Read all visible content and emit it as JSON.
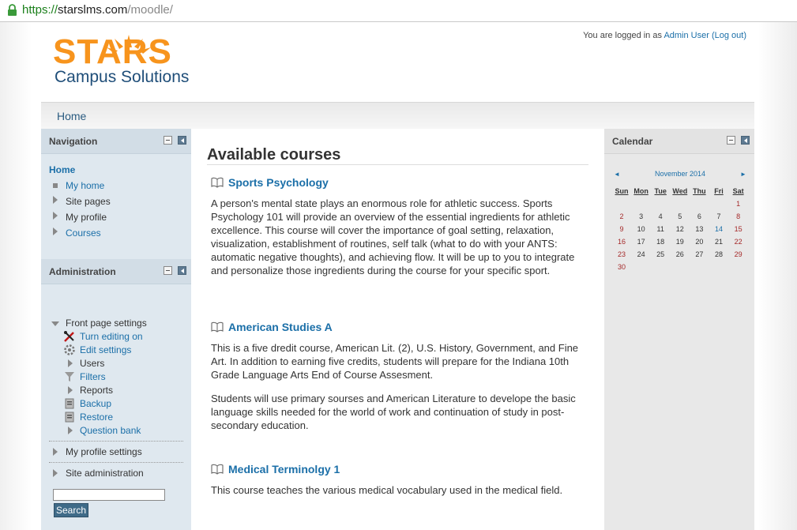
{
  "browser": {
    "url_protocol": "https://",
    "url_host": "starslms.com",
    "url_path": "/moodle/"
  },
  "header": {
    "logo_text": "STARS",
    "logo_subtext": "Campus Solutions",
    "login_prefix": "You are logged in as",
    "user_name": "Admin User",
    "logout_label": "(Log out)"
  },
  "breadcrumb": {
    "home": "Home"
  },
  "navigation": {
    "title": "Navigation",
    "home": "Home",
    "items": [
      {
        "label": "My home",
        "link": true
      },
      {
        "label": "Site pages",
        "link": false
      },
      {
        "label": "My profile",
        "link": false
      },
      {
        "label": "Courses",
        "link": true
      }
    ]
  },
  "administration": {
    "title": "Administration",
    "front_page_settings": "Front page settings",
    "front_items": [
      {
        "label": "Turn editing on",
        "icon": "edit-tools-icon",
        "link": true
      },
      {
        "label": "Edit settings",
        "icon": "gear-icon",
        "link": true
      },
      {
        "label": "Users",
        "icon": "expand-arrow-icon",
        "link": false
      },
      {
        "label": "Filters",
        "icon": "filter-icon",
        "link": true
      },
      {
        "label": "Reports",
        "icon": "expand-arrow-icon",
        "link": false
      },
      {
        "label": "Backup",
        "icon": "backup-icon",
        "link": true
      },
      {
        "label": "Restore",
        "icon": "restore-icon",
        "link": true
      },
      {
        "label": "Question bank",
        "icon": "expand-arrow-icon",
        "link": true
      }
    ],
    "my_profile_settings": "My profile settings",
    "site_administration": "Site administration",
    "search_button": "Search",
    "search_value": ""
  },
  "main": {
    "heading": "Available courses",
    "courses": [
      {
        "title": "Sports Psychology",
        "paragraphs": [
          "A person's mental state plays an enormous role for athletic success. Sports Psychology 101 will provide an overview of the essential ingredients for athletic excellence. This course will cover the importance of goal setting, relaxation, visualization, establishment of routines, self talk (what to do with your ANTS: automatic negative thoughts), and achieving flow. It will be up to you to integrate and personalize those ingredients during the course for your specific sport."
        ]
      },
      {
        "title": "American Studies A",
        "paragraphs": [
          "This is a five dredit course, American Lit. (2), U.S. History, Government, and Fine Art. In addition to earning five credits, students will prepare for the Indiana 10th Grade Language Arts End of Course Assesment.",
          "Students will use primary sourses and American Literature to develope the basic language skills needed for the world of work and continuation of study in post-secondary education."
        ]
      },
      {
        "title": "Medical Terminolgy 1",
        "paragraphs": [
          "This course teaches the various medical vocabulary used in the medical field."
        ]
      }
    ]
  },
  "calendar": {
    "title": "Calendar",
    "month": "November 2014",
    "prev": "◄",
    "next": "►",
    "weekdays": [
      "Sun",
      "Mon",
      "Tue",
      "Wed",
      "Thu",
      "Fri",
      "Sat"
    ],
    "first_weekday_index": 6,
    "days_in_month": 30,
    "today": 14
  },
  "colors": {
    "link": "#1b6fa8",
    "logo_orange": "#f7941d",
    "logo_blue": "#1f4e79",
    "weekend": "#a52a2a"
  }
}
